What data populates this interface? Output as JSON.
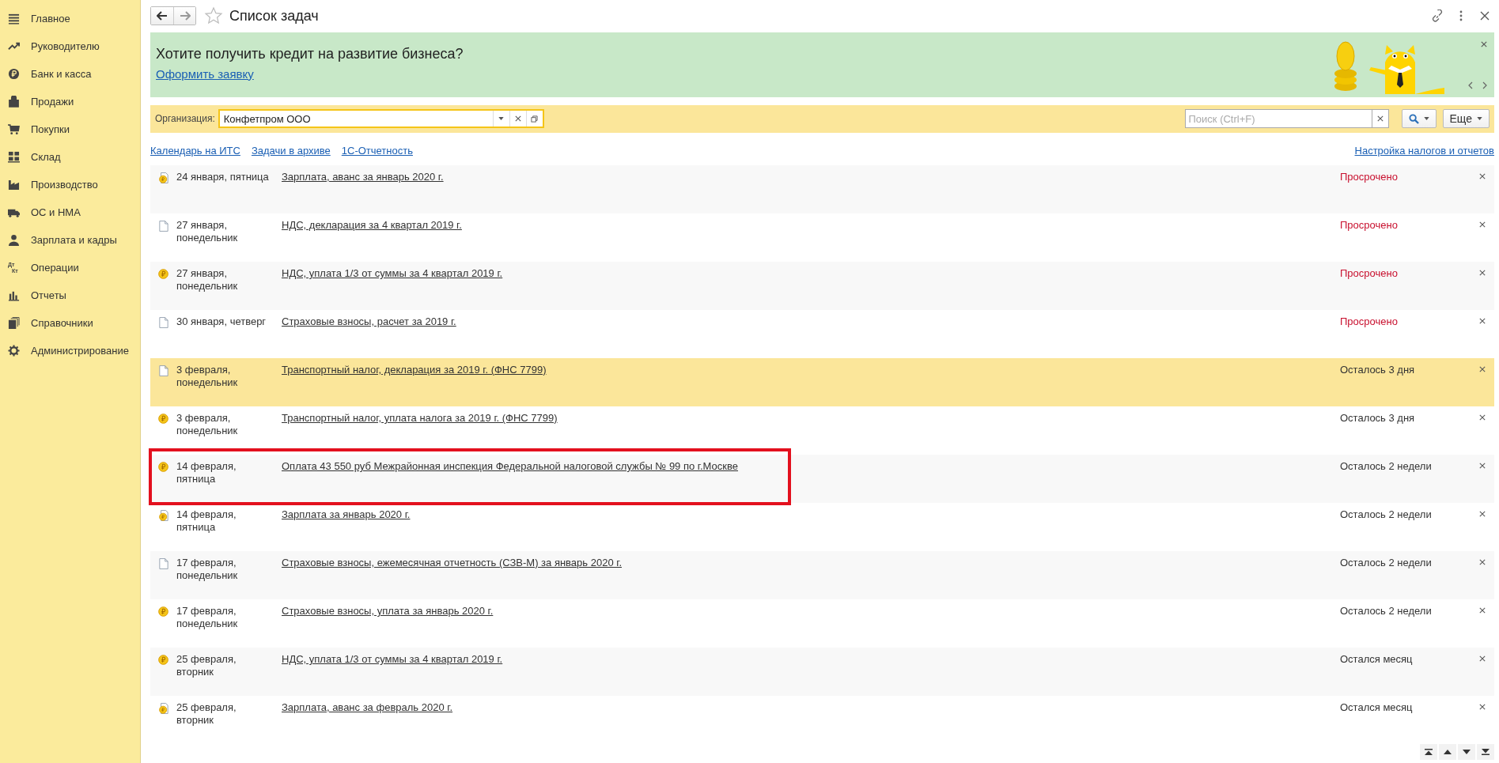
{
  "sidebar": {
    "items": [
      {
        "label": "Главное"
      },
      {
        "label": "Руководителю"
      },
      {
        "label": "Банк и касса"
      },
      {
        "label": "Продажи"
      },
      {
        "label": "Покупки"
      },
      {
        "label": "Склад"
      },
      {
        "label": "Производство"
      },
      {
        "label": "ОС и НМА"
      },
      {
        "label": "Зарплата и кадры"
      },
      {
        "label": "Операции",
        "icon_text": [
          "Дт",
          "Кт"
        ]
      },
      {
        "label": "Отчеты"
      },
      {
        "label": "Справочники"
      },
      {
        "label": "Администрирование"
      }
    ]
  },
  "header": {
    "title": "Список задач"
  },
  "banner": {
    "text": "Хотите получить кредит на развитие бизнеса?",
    "link": "Оформить заявку"
  },
  "filter": {
    "label": "Организация:",
    "value": "Конфетпром ООО",
    "search_placeholder": "Поиск (Ctrl+F)",
    "more_button": "Еще"
  },
  "links": [
    "Календарь на ИТС",
    "Задачи в архиве",
    "1С-Отчетность"
  ],
  "settings_link": "Настройка налогов и отчетов",
  "tasks": [
    {
      "kind": "coin-doc",
      "date": "24 января, пятница",
      "title": "Зарплата, аванс за январь 2020 г.",
      "status": "Просрочено",
      "overdue": true,
      "selected": false,
      "framed": false
    },
    {
      "kind": "doc",
      "date": "27 января, понедельник",
      "title": "НДС, декларация за 4 квартал 2019 г.",
      "status": "Просрочено",
      "overdue": true,
      "selected": false,
      "framed": false
    },
    {
      "kind": "coin",
      "date": "27 января, понедельник",
      "title": "НДС, уплата 1/3 от суммы за 4 квартал 2019 г.",
      "status": "Просрочено",
      "overdue": true,
      "selected": false,
      "framed": false
    },
    {
      "kind": "doc",
      "date": "30 января, четверг",
      "title": "Страховые взносы, расчет за 2019 г.",
      "status": "Просрочено",
      "overdue": true,
      "selected": false,
      "framed": false
    },
    {
      "kind": "doc",
      "date": "3 февраля, понедельник",
      "title": "Транспортный налог, декларация за 2019 г. (ФНС 7799)",
      "status": "Осталось 3 дня",
      "overdue": false,
      "selected": true,
      "framed": false
    },
    {
      "kind": "coin",
      "date": "3 февраля, понедельник",
      "title": "Транспортный налог, уплата налога за 2019 г. (ФНС 7799)",
      "status": "Осталось 3 дня",
      "overdue": false,
      "selected": false,
      "framed": false
    },
    {
      "kind": "coin",
      "date": "14 февраля, пятница",
      "title": "Оплата 43 550 руб Межрайонная инспекция Федеральной налоговой службы № 99 по г.Москве",
      "status": "Осталось 2 недели",
      "overdue": false,
      "selected": false,
      "framed": true
    },
    {
      "kind": "coin-doc",
      "date": "14 февраля, пятница",
      "title": "Зарплата за январь 2020 г.",
      "status": "Осталось 2 недели",
      "overdue": false,
      "selected": false,
      "framed": false
    },
    {
      "kind": "doc",
      "date": "17 февраля, понедельник",
      "title": "Страховые взносы, ежемесячная отчетность (СЗВ-М) за январь 2020 г.",
      "status": "Осталось 2 недели",
      "overdue": false,
      "selected": false,
      "framed": false
    },
    {
      "kind": "coin",
      "date": "17 февраля, понедельник",
      "title": "Страховые взносы, уплата за январь 2020 г.",
      "status": "Осталось 2 недели",
      "overdue": false,
      "selected": false,
      "framed": false
    },
    {
      "kind": "coin",
      "date": "25 февраля, вторник",
      "title": "НДС, уплата 1/3 от суммы за 4 квартал 2019 г.",
      "status": "Остался месяц",
      "overdue": false,
      "selected": false,
      "framed": false
    },
    {
      "kind": "coin-doc",
      "date": "25 февраля, вторник",
      "title": "Зарплата, аванс за февраль 2020 г.",
      "status": "Остался месяц",
      "overdue": false,
      "selected": false,
      "framed": false
    }
  ]
}
